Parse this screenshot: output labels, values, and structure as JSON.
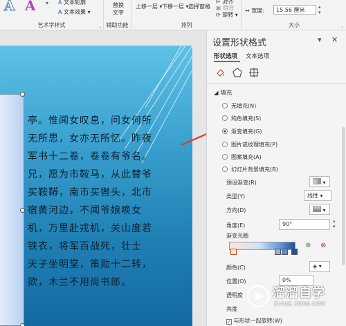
{
  "ribbon": {
    "wordart_group": "艺术字样式",
    "text_outline": "文本轮廓",
    "text_effects": "文本效果",
    "accessibility_group": "辅助功能",
    "alt_text_line1": "替换",
    "alt_text_line2": "文字",
    "arrange_group": "排列",
    "bring_forward": "上移一层",
    "send_backward": "下移一层",
    "selection_pane": "选择窗格",
    "align": "对齐",
    "group": "组合",
    "rotate": "旋转",
    "size_group": "大小",
    "width_label": "宽度:",
    "width_value": "15.56 厘米"
  },
  "poem": {
    "lines": [
      "亭。惟闻女叹息，问女何所",
      "无所思，女亦无所忆。昨夜",
      "军书十二卷，卷卷有爷名。",
      "兄，愿为市鞍马，从此替爷",
      "买鞍鞯，南市买辔头，北市",
      "宿黄河边，不闻爷娘唤女",
      "机，万里赴戎机，关山度若",
      "铁衣，将军百战死，壮士",
      "天子坐明堂，策勋十二转，",
      "欲，木兰不用尚书郎。"
    ]
  },
  "pane": {
    "title": "设置形状格式",
    "tab_shape": "形状选项",
    "tab_text": "文本选项",
    "fill_section": "填充",
    "options": [
      {
        "label": "无填充(N)",
        "selected": false
      },
      {
        "label": "纯色填充(S)",
        "selected": false
      },
      {
        "label": "渐变填充(G)",
        "selected": true
      },
      {
        "label": "图片或纹理填充(P)",
        "selected": false
      },
      {
        "label": "图案填充(A)",
        "selected": false
      },
      {
        "label": "幻灯片背景填充(B)",
        "selected": false
      }
    ],
    "preset_label": "预设渐变(R)",
    "type_label": "类型(Y)",
    "type_value": "线性",
    "direction_label": "方向(D)",
    "angle_label": "角度(E)",
    "angle_value": "90°",
    "stops_label": "渐变光圈",
    "color_label": "颜色(C)",
    "position_label": "位置(O)",
    "position_value": "0%",
    "transparency_label": "透明度",
    "brightness_label": "亮度",
    "rotate_with_shape": "与形状一起旋转(W)"
  },
  "watermark": {
    "brand": "溜溜自学",
    "url": "ZIXUE.3D66.COM"
  },
  "colors": {
    "annotation_arrow": "#e03a2b",
    "pane_accent": "#d24726"
  }
}
